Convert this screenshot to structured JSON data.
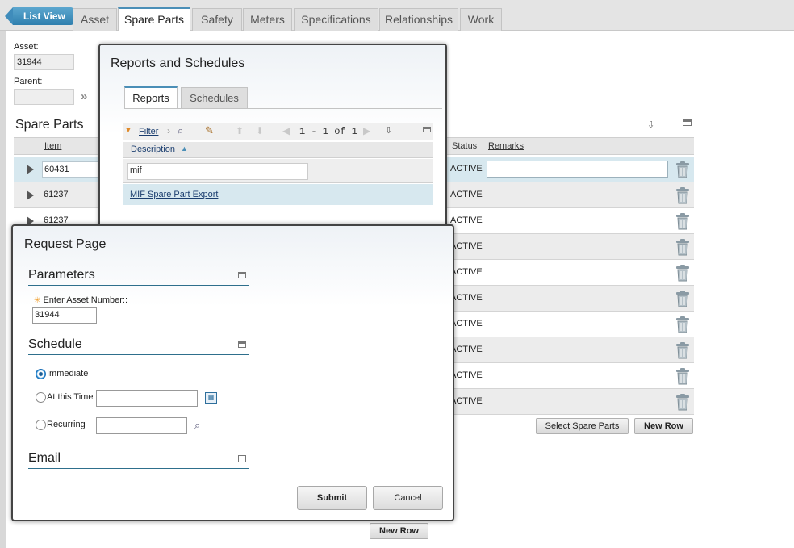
{
  "topbar": {
    "list_view": "List View",
    "tabs": [
      "Asset",
      "Spare Parts",
      "Safety",
      "Meters",
      "Specifications",
      "Relationships",
      "Work"
    ],
    "active_tab": "Spare Parts"
  },
  "header": {
    "asset_label": "Asset:",
    "asset_value": "31944",
    "parent_label": "Parent:",
    "parent_value": ""
  },
  "spare_parts": {
    "title": "Spare Parts",
    "columns": {
      "item": "Item",
      "status": "Status",
      "remarks": "Remarks"
    },
    "rows": [
      {
        "item": "60431",
        "status": "ACTIVE"
      },
      {
        "item": "61237",
        "status": "ACTIVE"
      },
      {
        "item": "61237",
        "status": "ACTIVE"
      },
      {
        "item": "",
        "status": "ACTIVE"
      },
      {
        "item": "",
        "status": "ACTIVE"
      },
      {
        "item": "",
        "status": "ACTIVE"
      },
      {
        "item": "",
        "status": "ACTIVE"
      },
      {
        "item": "",
        "status": "ACTIVE"
      },
      {
        "item": "",
        "status": "ACTIVE"
      },
      {
        "item": "",
        "status": "ACTIVE"
      }
    ],
    "select_button": "Select Spare Parts",
    "new_row_button": "New Row",
    "bottom_new_row": "New Row"
  },
  "reports_dialog": {
    "title": "Reports and Schedules",
    "tabs": [
      "Reports",
      "Schedules"
    ],
    "filter_label": "Filter",
    "pagination": "1 - 1 of 1",
    "column_description": "Description",
    "filter_value": "mif",
    "row": "MIF Spare Part Export"
  },
  "request_dialog": {
    "title": "Request Page",
    "parameters_title": "Parameters",
    "asset_number_label": "Enter Asset Number::",
    "asset_number_value": "31944",
    "schedule_title": "Schedule",
    "immediate_label": "Immediate",
    "at_time_label": "At this Time",
    "at_time_value": "",
    "recurring_label": "Recurring",
    "recurring_value": "",
    "email_title": "Email",
    "submit": "Submit",
    "cancel": "Cancel"
  },
  "colors": {
    "accent": "#2f7fae",
    "selected_row": "#d7e8ef",
    "section_rule": "#2e6f8c"
  }
}
